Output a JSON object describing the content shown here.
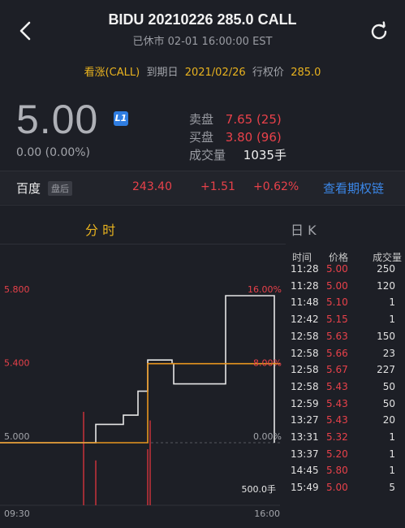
{
  "header": {
    "title": "BIDU 20210226 285.0 CALL",
    "subtitle": "已休市 02-01 16:00:00 EST",
    "back_icon": "chevron-left-icon",
    "refresh_icon": "refresh-icon"
  },
  "meta": {
    "type": "看涨(CALL)",
    "expiry_label": "到期日",
    "expiry": "2021/02/26",
    "strike_label": "行权价",
    "strike": "285.0"
  },
  "quote": {
    "price": "5.00",
    "level_badge": "L1",
    "change": "0.00 (0.00%)",
    "ask_label": "卖盘",
    "ask": "7.65 (25)",
    "bid_label": "买盘",
    "bid": "3.80 (96)",
    "volume_label": "成交量",
    "volume": "1035手"
  },
  "underlying": {
    "name": "百度",
    "session_badge": "盘后",
    "price": "243.40",
    "change": "+1.51",
    "change_pct": "+0.62%",
    "link": "查看期权链"
  },
  "tabs": {
    "intraday": "分 时",
    "daily": "日 K"
  },
  "colors": {
    "background": "#1d1f26",
    "accent_gold": "#e8b21f",
    "red": "#e8414a",
    "link_blue": "#3b87e8",
    "price_line": "#e6e6e6",
    "avg_line": "#e8951f"
  },
  "chart_data": {
    "type": "line",
    "y_labels_left": [
      "5.800",
      "5.400",
      "5.000"
    ],
    "y_labels_right": [
      "16.00%",
      "8.00%",
      "0.00%"
    ],
    "x_start": "09:30",
    "x_end": "16:00",
    "ylim": [
      4.6,
      6.0
    ],
    "volume_label": "500.0手",
    "series": [
      {
        "values": [
          [
            0,
            5.0
          ],
          [
            118,
            5.0
          ],
          [
            118,
            5.1
          ],
          [
            152,
            5.1
          ],
          [
            152,
            5.15
          ],
          [
            170,
            5.15
          ],
          [
            170,
            5.28
          ],
          [
            182,
            5.28
          ],
          [
            182,
            5.45
          ],
          [
            212,
            5.45
          ],
          [
            212,
            5.43
          ],
          [
            214,
            5.43
          ],
          [
            214,
            5.4
          ],
          [
            214,
            5.32
          ],
          [
            278,
            5.32
          ],
          [
            278,
            5.8
          ],
          [
            338,
            5.8
          ],
          [
            338,
            5.0
          ]
        ]
      },
      {
        "values": [
          [
            0,
            5.0
          ],
          [
            182,
            5.0
          ],
          [
            182,
            5.43
          ],
          [
            345,
            5.43
          ]
        ]
      }
    ],
    "volume_bars": [
      [
        103,
        250
      ],
      [
        118,
        120
      ],
      [
        182,
        150
      ],
      [
        185,
        227
      ]
    ]
  },
  "trades": {
    "headers": [
      "时间",
      "价格",
      "成交量"
    ],
    "rows": [
      [
        "11:28",
        "5.00",
        "250"
      ],
      [
        "11:28",
        "5.00",
        "120"
      ],
      [
        "11:48",
        "5.10",
        "1"
      ],
      [
        "12:42",
        "5.15",
        "1"
      ],
      [
        "12:58",
        "5.63",
        "150"
      ],
      [
        "12:58",
        "5.66",
        "23"
      ],
      [
        "12:58",
        "5.67",
        "227"
      ],
      [
        "12:58",
        "5.43",
        "50"
      ],
      [
        "12:59",
        "5.43",
        "50"
      ],
      [
        "13:27",
        "5.43",
        "20"
      ],
      [
        "13:31",
        "5.32",
        "1"
      ],
      [
        "13:37",
        "5.20",
        "1"
      ],
      [
        "14:45",
        "5.80",
        "1"
      ],
      [
        "15:49",
        "5.00",
        "5"
      ]
    ]
  }
}
